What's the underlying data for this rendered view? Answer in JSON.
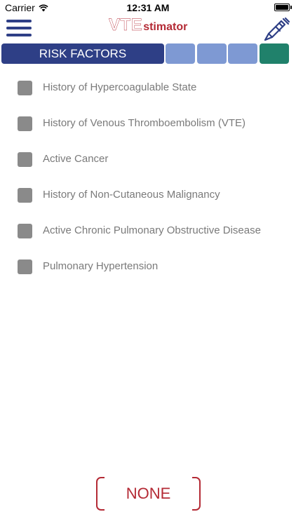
{
  "status_bar": {
    "carrier": "Carrier",
    "time": "12:31 AM"
  },
  "header": {
    "menu_icon": "hamburger-menu-icon",
    "logo": {
      "prefix": "VTE",
      "suffix": "stimator"
    },
    "edit_icon": "pen-edit-icon"
  },
  "tabs": {
    "active_label": "RISK FACTORS",
    "colors": {
      "active": "#2e3f86",
      "pending": "#7e99d3",
      "final": "#20816b"
    }
  },
  "risk_factors": [
    {
      "label": "History of Hypercoagulable State",
      "checked": false
    },
    {
      "label": "History of Venous Thromboembolism (VTE)",
      "checked": false
    },
    {
      "label": "Active Cancer",
      "checked": false
    },
    {
      "label": "History of Non-Cutaneous Malignancy",
      "checked": false
    },
    {
      "label": "Active Chronic Pulmonary Obstructive Disease",
      "checked": false
    },
    {
      "label": "Pulmonary Hypertension",
      "checked": false
    }
  ],
  "footer": {
    "none_button_label": "NONE"
  },
  "colors": {
    "brand_red": "#b42a35",
    "checkbox_gray": "#8a8a8a",
    "label_gray": "#7a7a7a"
  }
}
